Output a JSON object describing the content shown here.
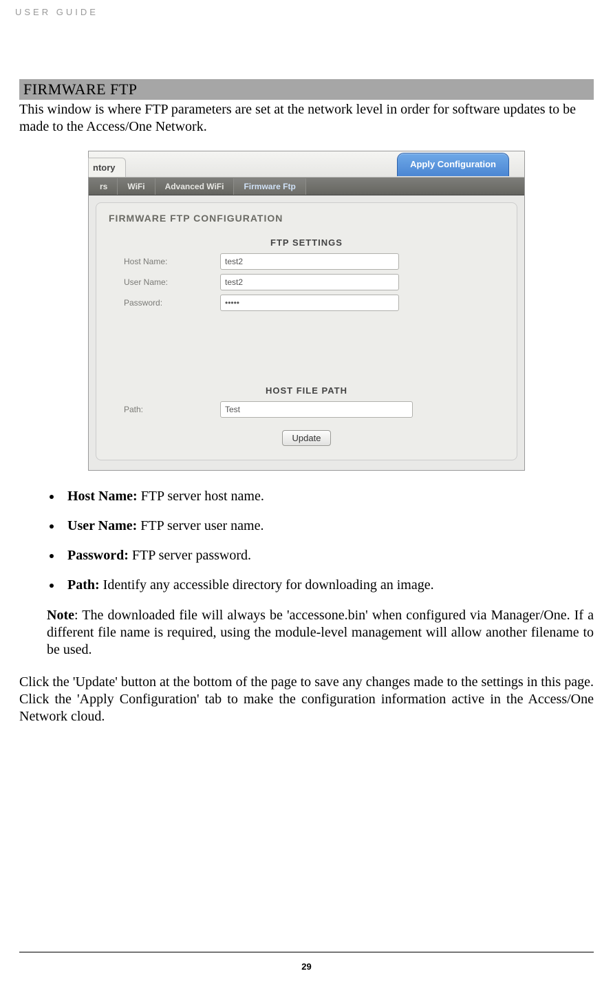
{
  "header": {
    "label": "USER GUIDE"
  },
  "section": {
    "title": "FIRMWARE FTP",
    "intro": "This window is where FTP parameters are set at the network level in order for software updates to be made to the Access/One Network."
  },
  "screenshot": {
    "tabs": {
      "left": "ntory",
      "apply": "Apply Configuration"
    },
    "subtabs": {
      "rs": "rs",
      "wifi": "WiFi",
      "advwifi": "Advanced WiFi",
      "fwftp": "Firmware Ftp"
    },
    "panelTitle": "FIRMWARE FTP CONFIGURATION",
    "ftpHeading": "FTP SETTINGS",
    "fields": {
      "hostLabel": "Host Name:",
      "hostValue": "test2",
      "userLabel": "User Name:",
      "userValue": "test2",
      "passLabel": "Password:",
      "passValue": "•••••"
    },
    "pathHeading": "HOST FILE PATH",
    "pathLabel": "Path:",
    "pathValue": "Test",
    "updateBtn": "Update"
  },
  "bullets": {
    "b1t": "Host Name:",
    "b1d": " FTP server host name.",
    "b2t": "User Name:",
    "b2d": " FTP server user name.",
    "b3t": "Password:",
    "b3d": " FTP server password.",
    "b4t": "Path:",
    "b4d": " Identify any accessible directory for downloading an image."
  },
  "note": {
    "label": "Note",
    "text": ": The downloaded file will always be 'accessone.bin' when configured via Manager/One. If a different file name is required, using the module-level management will allow another filename to be used."
  },
  "closing": "Click the 'Update' button at the bottom of the page to save any changes made to the settings in this page. Click the 'Apply Configuration' tab to make the configuration information active in the Access/One Network cloud.",
  "pageNumber": "29"
}
